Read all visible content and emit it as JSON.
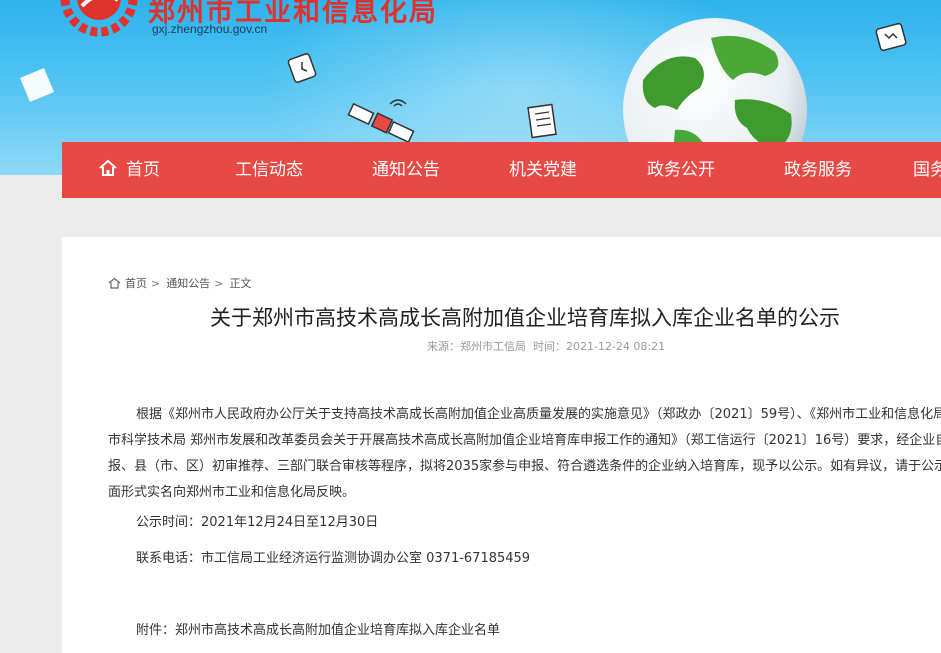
{
  "site": {
    "title": "郑州市工业和信息化局",
    "domain": "gxj.zhengzhou.gov.cn"
  },
  "nav": {
    "items": [
      {
        "label": "首页",
        "icon": "home-icon"
      },
      {
        "label": "工信动态"
      },
      {
        "label": "通知公告"
      },
      {
        "label": "机关党建"
      },
      {
        "label": "政务公开"
      },
      {
        "label": "政务服务"
      },
      {
        "label": "国务"
      }
    ]
  },
  "breadcrumb": {
    "icon": "home-icon",
    "items": [
      "首页",
      "通知公告",
      "正文"
    ]
  },
  "article": {
    "title": "关于郑州市高技术高成长高附加值企业培育库拟入库企业名单的公示",
    "source": "来源：郑州市工信局",
    "time": "时间：2021-12-24 08:21",
    "body_lines": [
      "根据《郑州市人民政府办公厅关于支持高技术高成长高附加值企业高质量发展的实施意见》（郑政办〔2021〕59号）、《郑州市工业和信息化局",
      "市科学技术局 郑州市发展和改革委员会关于开展高技术高成长高附加值企业培育库申报工作的通知》（郑工信运行〔2021〕16号）要求，经企业自愿",
      "报、县（市、区）初审推荐、三部门联合审核等程序，拟将2035家参与申报、符合遴选条件的企业纳入培育库，现予以公示。如有异议，请于公示期",
      "面形式实名向郑州市工业和信息化局反映。"
    ],
    "period": "公示时间：2021年12月24日至12月30日",
    "contact": "联系电话：市工信局工业经济运行监测协调办公室 0371-67185459",
    "attachment": "附件：郑州市高技术高成长高附加值企业培育库拟入库企业名单"
  },
  "colors": {
    "nav_red": "#e74a45",
    "title_red": "#e0322c",
    "sky": "#2eb3ec"
  }
}
